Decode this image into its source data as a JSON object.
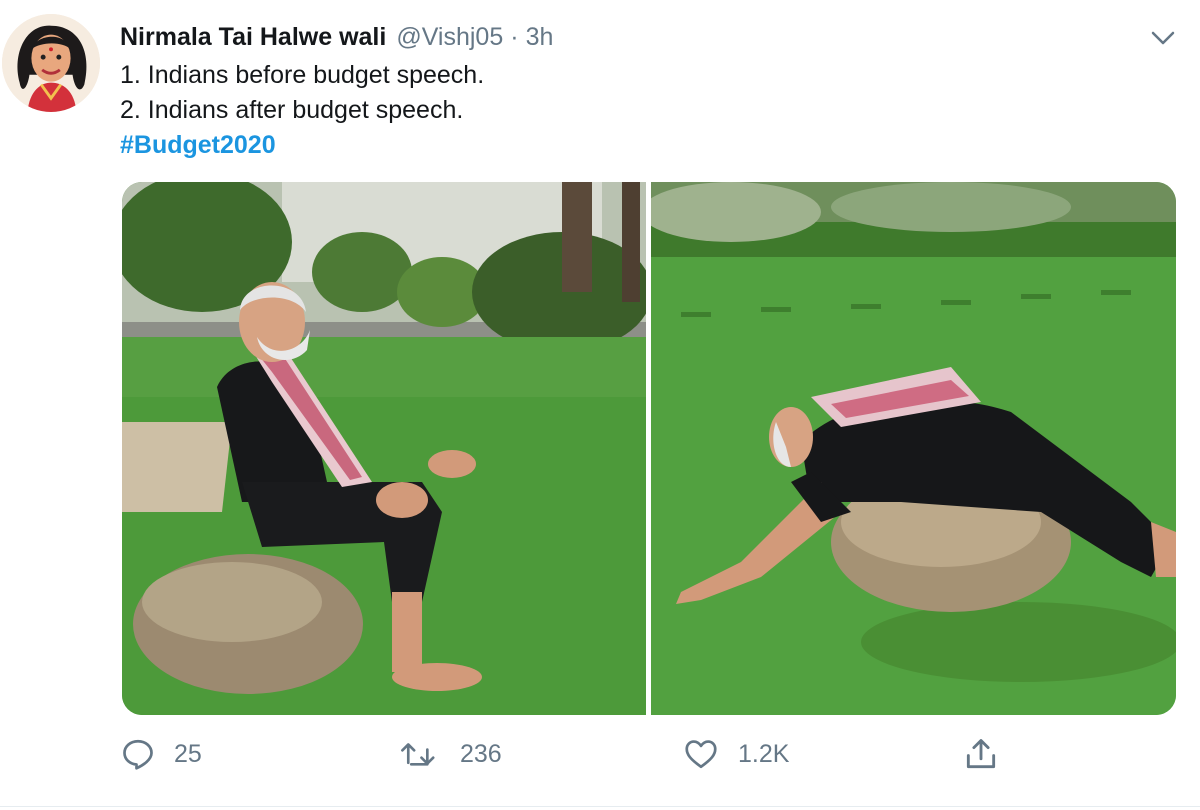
{
  "tweet": {
    "author": {
      "display_name": "Nirmala Tai Halwe wali",
      "handle": "@Vishj05",
      "separator": "·",
      "time": "3h",
      "avatar_icon": "caricature-avatar"
    },
    "text_lines": [
      "1. Indians before budget speech.",
      "2. Indians after budget speech."
    ],
    "hashtag": "#Budget2020",
    "menu_icon": "chevron-down-icon",
    "media": [
      {
        "description_icon": "photo-man-sitting-on-rock"
      },
      {
        "description_icon": "photo-man-lying-on-rock"
      }
    ],
    "actions": {
      "reply": {
        "icon": "reply-icon",
        "count": "25"
      },
      "retweet": {
        "icon": "retweet-icon",
        "count": "236"
      },
      "like": {
        "icon": "heart-icon",
        "count": "1.2K"
      },
      "share": {
        "icon": "share-icon"
      }
    },
    "colors": {
      "hashtag": "#1b95e0",
      "secondary_text": "#657786",
      "primary_text": "#14171a"
    }
  }
}
